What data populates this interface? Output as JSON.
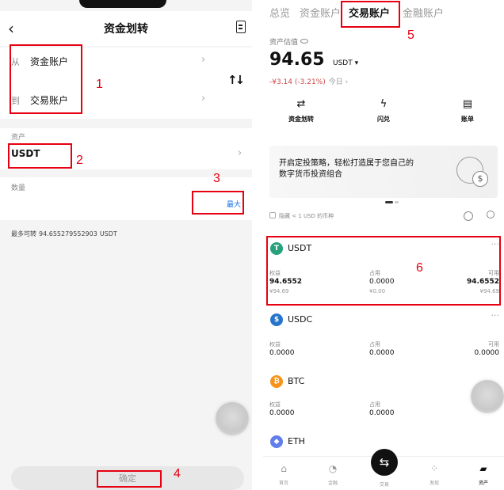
{
  "left": {
    "header": {
      "title": "资金划转"
    },
    "from": {
      "label": "从",
      "value": "资金账户"
    },
    "to": {
      "label": "到",
      "value": "交易账户"
    },
    "asset": {
      "label": "资产",
      "value": "USDT"
    },
    "amount": {
      "label": "数量",
      "max_label": "最大"
    },
    "available": {
      "label": "最多可转",
      "value": "94.6552795529​03",
      "unit": "USDT"
    },
    "confirm_label": "确定"
  },
  "right": {
    "tabs": [
      "总览",
      "资金账户",
      "交易账户",
      "金融账户"
    ],
    "estimate_label": "资产估值",
    "balance": "94.65",
    "balance_unit": "USDT ▾",
    "pnl": "-¥3.14 (-3.21%)",
    "pnl_period": "今日 ›",
    "actions": [
      "资金划转",
      "闪兑",
      "账单"
    ],
    "banner": {
      "line1": "开启定投策略，轻松打造属于您自己的",
      "line2": "数字货币投资组合"
    },
    "hide_small": "隐藏 < 1 USD 的币种",
    "columns": {
      "equity": "权益",
      "occupied": "占用",
      "available": "可用"
    },
    "assets": [
      {
        "symbol": "USDT",
        "icon": "T",
        "color": "#26a17b",
        "equity": "94.6552",
        "occupied": "0.0000",
        "available": "94.6552",
        "equity_cny": "¥94.69",
        "occupied_cny": "¥0.00",
        "available_cny": "¥94.69"
      },
      {
        "symbol": "USDC",
        "icon": "$",
        "color": "#2775ca",
        "equity": "0.0000",
        "occupied": "0.0000",
        "available": "0.0000"
      },
      {
        "symbol": "BTC",
        "icon": "₿",
        "color": "#f7931a",
        "equity": "0.0000",
        "occupied": "0.0000",
        "available": "可用"
      },
      {
        "symbol": "ETH",
        "icon": "◆",
        "color": "#627eea"
      }
    ],
    "nav": [
      "首页",
      "金融",
      "交易",
      "发现",
      "资产"
    ]
  },
  "annotations": {
    "n1": "1",
    "n2": "2",
    "n3": "3",
    "n4": "4",
    "n5": "5",
    "n6": "6"
  },
  "colors": {
    "annotation": "#e60012",
    "accent": "#1a73e8",
    "loss": "#d04a4a"
  }
}
